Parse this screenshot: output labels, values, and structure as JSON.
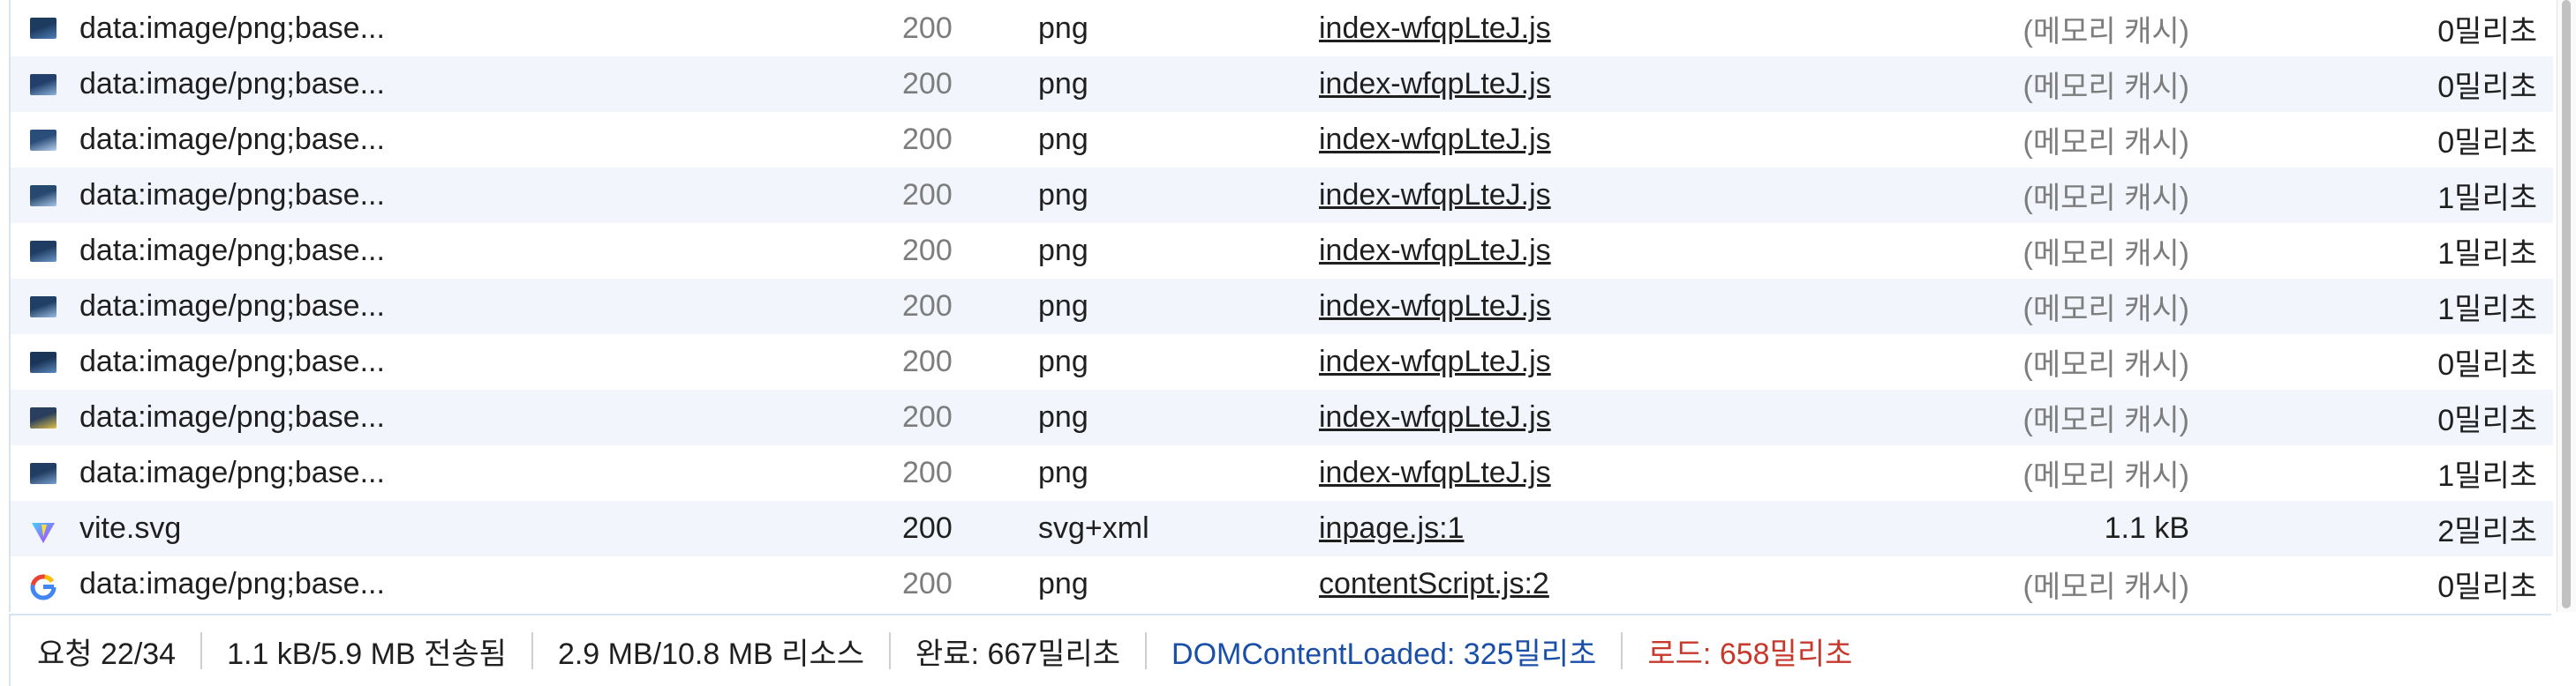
{
  "colors": {
    "footer_dom": "#1a4fa8",
    "footer_load": "#c6392c",
    "dim_text": "#7d7d7d",
    "accent_border": "#d6e3f1"
  },
  "rows": [
    {
      "name": "data:image/png;base...",
      "status": "200",
      "type": "png",
      "initiator": "index-wfqpLteJ.js",
      "size": "(메모리 캐시)",
      "time": "0밀리초",
      "icon": "image-thumbnail-icon",
      "dim": true
    },
    {
      "name": "data:image/png;base...",
      "status": "200",
      "type": "png",
      "initiator": "index-wfqpLteJ.js",
      "size": "(메모리 캐시)",
      "time": "0밀리초",
      "icon": "image-thumbnail-icon",
      "dim": true
    },
    {
      "name": "data:image/png;base...",
      "status": "200",
      "type": "png",
      "initiator": "index-wfqpLteJ.js",
      "size": "(메모리 캐시)",
      "time": "0밀리초",
      "icon": "image-thumbnail-icon",
      "dim": true
    },
    {
      "name": "data:image/png;base...",
      "status": "200",
      "type": "png",
      "initiator": "index-wfqpLteJ.js",
      "size": "(메모리 캐시)",
      "time": "1밀리초",
      "icon": "image-thumbnail-icon",
      "dim": true
    },
    {
      "name": "data:image/png;base...",
      "status": "200",
      "type": "png",
      "initiator": "index-wfqpLteJ.js",
      "size": "(메모리 캐시)",
      "time": "1밀리초",
      "icon": "image-thumbnail-icon",
      "dim": true
    },
    {
      "name": "data:image/png;base...",
      "status": "200",
      "type": "png",
      "initiator": "index-wfqpLteJ.js",
      "size": "(메모리 캐시)",
      "time": "1밀리초",
      "icon": "image-thumbnail-icon",
      "dim": true
    },
    {
      "name": "data:image/png;base...",
      "status": "200",
      "type": "png",
      "initiator": "index-wfqpLteJ.js",
      "size": "(메모리 캐시)",
      "time": "0밀리초",
      "icon": "image-thumbnail-icon",
      "dim": true
    },
    {
      "name": "data:image/png;base...",
      "status": "200",
      "type": "png",
      "initiator": "index-wfqpLteJ.js",
      "size": "(메모리 캐시)",
      "time": "0밀리초",
      "icon": "image-thumbnail-icon",
      "dim": true
    },
    {
      "name": "data:image/png;base...",
      "status": "200",
      "type": "png",
      "initiator": "index-wfqpLteJ.js",
      "size": "(메모리 캐시)",
      "time": "1밀리초",
      "icon": "image-thumbnail-icon",
      "dim": true
    },
    {
      "name": "vite.svg",
      "status": "200",
      "type": "svg+xml",
      "initiator": "inpage.js:1",
      "size": "1.1 kB",
      "time": "2밀리초",
      "icon": "vite-logo-icon",
      "dim": false
    },
    {
      "name": "data:image/png;base...",
      "status": "200",
      "type": "png",
      "initiator": "contentScript.js:2",
      "size": "(메모리 캐시)",
      "time": "0밀리초",
      "icon": "google-logo-icon",
      "dim": true
    }
  ],
  "footer": {
    "requests": "요청 22/34",
    "transferred": "1.1 kB/5.9 MB 전송됨",
    "resources": "2.9 MB/10.8 MB 리소스",
    "finish": "완료: 667밀리초",
    "dom_content_loaded": "DOMContentLoaded: 325밀리초",
    "load": "로드: 658밀리초"
  }
}
